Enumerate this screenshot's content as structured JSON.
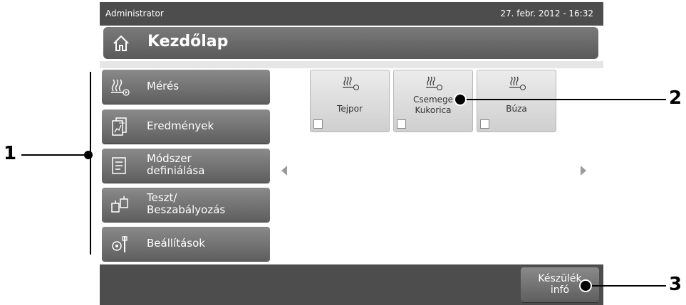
{
  "status": {
    "user": "Administrator",
    "datetime": "27. febr. 2012 - 16:32"
  },
  "header": {
    "title": "Kezdőlap",
    "icon": "home-icon"
  },
  "menu": {
    "items": [
      {
        "label": "Mérés",
        "icon": "heating-measure-icon"
      },
      {
        "label": "Eredmények",
        "icon": "results-document-icon"
      },
      {
        "label": "Módszer\ndefiniálása",
        "icon": "method-define-icon"
      },
      {
        "label": "Teszt/\nBeszabályozás",
        "icon": "test-weights-icon"
      },
      {
        "label": "Beállítások",
        "icon": "settings-tools-icon"
      }
    ]
  },
  "shortcuts": [
    {
      "label": "Tejpor",
      "icon": "heating-measure-icon"
    },
    {
      "label": "Csemege\nKukorica",
      "icon": "heating-measure-icon"
    },
    {
      "label": "Búza",
      "icon": "heating-measure-icon"
    }
  ],
  "footer": {
    "info_button": "Készülék\ninfó"
  },
  "callouts": {
    "c1": "1",
    "c2": "2",
    "c3": "3"
  }
}
